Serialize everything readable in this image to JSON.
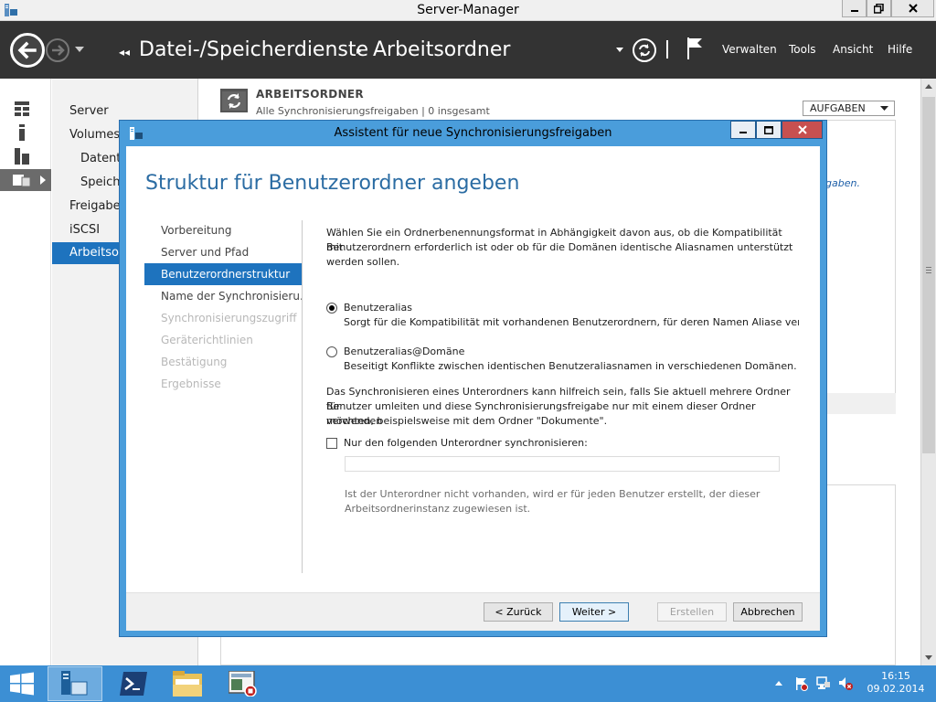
{
  "window": {
    "title": "Server-Manager",
    "minimize_label": "▁",
    "maximize_label": "❐",
    "close_label": "✕"
  },
  "navbar": {
    "breadcrumb_root": "Datei-/Speicherdienste",
    "breadcrumb_current": "Arbeitsordner",
    "menu": {
      "manage": "Verwalten",
      "tools": "Tools",
      "view": "Ansicht",
      "help": "Hilfe"
    }
  },
  "nav": {
    "items": [
      {
        "label": "Server"
      },
      {
        "label": "Volumes"
      },
      {
        "label": "Datent"
      },
      {
        "label": "Speich"
      },
      {
        "label": "Freigabe"
      },
      {
        "label": "iSCSI"
      },
      {
        "label": "Arbeitsor"
      }
    ]
  },
  "main": {
    "section_title": "ARBEITSORDNER",
    "section_subtitle": "Alle Synchronisierungsfreigaben | 0 insgesamt",
    "tasks_label": "AUFGABEN",
    "bg_fragment": "igaben."
  },
  "dialog": {
    "title": "Assistent für neue Synchronisierungsfreigaben",
    "heading": "Struktur für Benutzerordner angeben",
    "steps": [
      {
        "label": "Vorbereitung",
        "state": "done"
      },
      {
        "label": "Server und Pfad",
        "state": "done"
      },
      {
        "label": "Benutzerordnerstruktur",
        "state": "current"
      },
      {
        "label": "Name der Synchronisieru...",
        "state": "done"
      },
      {
        "label": "Synchronisierungszugriff",
        "state": "disabled"
      },
      {
        "label": "Geräterichtlinien",
        "state": "disabled"
      },
      {
        "label": "Bestätigung",
        "state": "disabled"
      },
      {
        "label": "Ergebnisse",
        "state": "disabled"
      }
    ],
    "intro_line1": "Wählen Sie ein Ordnerbenennungsformat in Abhängigkeit davon aus, ob die Kompatibilität mit",
    "intro_line2": "Benutzerordnern erforderlich ist oder ob für die Domänen identische Aliasnamen unterstützt",
    "intro_line3": "werden sollen.",
    "option1_title": "Benutzeralias",
    "option1_desc": "Sorgt für die Kompatibilität mit vorhandenen Benutzerordnern, für deren Namen Aliase verwe",
    "option1_selected": true,
    "option2_title": "Benutzeralias@Domäne",
    "option2_desc": "Beseitigt Konflikte zwischen identischen Benutzeraliasnamen in verschiedenen Domänen.",
    "option2_selected": false,
    "sub_line1": "Das Synchronisieren eines Unterordners kann hilfreich sein, falls Sie aktuell mehrere Ordner für",
    "sub_line2": "Benutzer umleiten und diese Synchronisierungsfreigabe nur mit einem dieser Ordner verwenden",
    "sub_line3": "möchten, beispielsweise mit dem Ordner \"Dokumente\".",
    "checkbox_label": "Nur den folgenden Unterordner synchronisieren:",
    "checkbox_checked": false,
    "subfolder_value": "",
    "hint_line1": "Ist der Unterordner nicht vorhanden, wird er für jeden Benutzer erstellt, der dieser",
    "hint_line2": "Arbeitsordnerinstanz zugewiesen ist.",
    "buttons": {
      "back": "< Zurück",
      "next": "Weiter >",
      "create": "Erstellen",
      "cancel": "Abbrechen"
    }
  },
  "taskbar": {
    "time": "16:15",
    "date": "09.02.2014"
  },
  "colors": {
    "navbar_bg": "#333333",
    "accent_blue": "#1e73be",
    "dialog_frame": "#4a9ddb",
    "taskbar_bg": "#3c8fd4",
    "close_red": "#c75050"
  }
}
